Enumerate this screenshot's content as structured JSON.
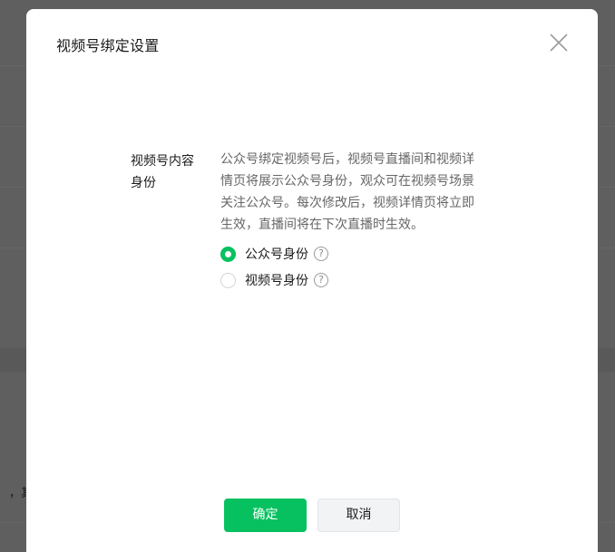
{
  "background": {
    "snippet_text": "，其他"
  },
  "dialog": {
    "title": "视频号绑定设置",
    "close_icon": "close-icon",
    "field": {
      "label_line1": "视频号内容",
      "label_line2": "身份",
      "description": [
        "公众号绑定视频号后，视频号直播间和视频详",
        "情页将展示公众号身份，观众可在视频号场景",
        "关注公众号。每次修改后，视频详情页将立即",
        "生效，直播间将在下次直播时生效。"
      ],
      "options": [
        {
          "label": "公众号身份",
          "selected": true
        },
        {
          "label": "视频号身份",
          "selected": false
        }
      ],
      "help_glyph": "?"
    },
    "buttons": {
      "confirm": "确定",
      "cancel": "取消"
    },
    "colors": {
      "accent": "#07c160",
      "overlay": "#5f5f5f"
    }
  }
}
